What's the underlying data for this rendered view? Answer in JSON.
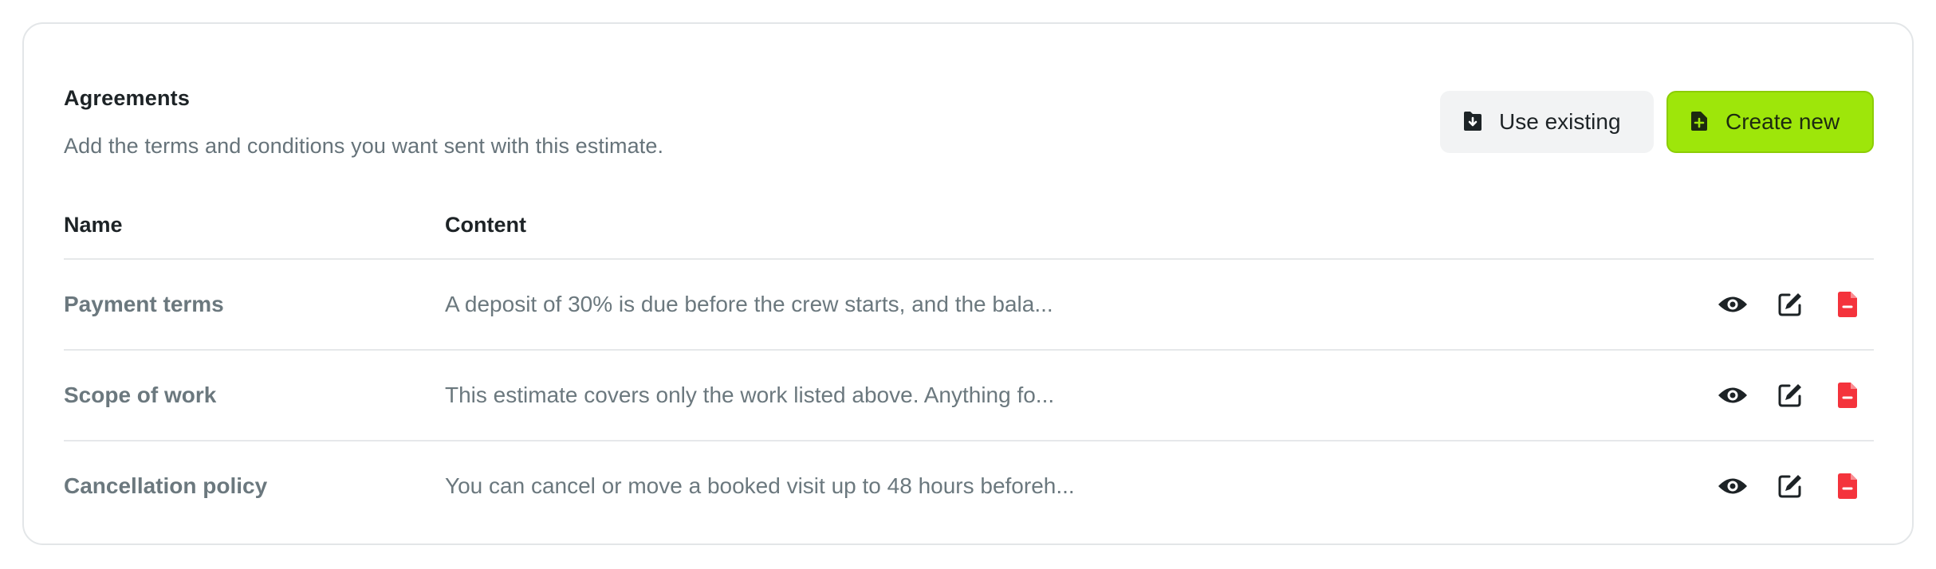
{
  "section": {
    "title": "Agreements",
    "subtitle": "Add the terms and conditions you want sent with this estimate."
  },
  "actions": {
    "use_existing_label": "Use existing",
    "use_existing_icon": "folder-download-icon",
    "create_new_label": "Create new",
    "create_new_icon": "file-plus-icon"
  },
  "table": {
    "columns": [
      "Name",
      "Content"
    ],
    "rows": [
      {
        "name": "Payment terms",
        "content": "A deposit of 30% is due before the crew starts, and the bala..."
      },
      {
        "name": "Scope of work",
        "content": "This estimate covers only the work listed above. Anything fo..."
      },
      {
        "name": "Cancellation policy",
        "content": "You can cancel or move a booked visit up to 48 hours beforeh..."
      }
    ],
    "row_action_icons": [
      "eye-icon",
      "edit-icon",
      "file-minus-icon"
    ]
  },
  "colors": {
    "primary": "#9ee60a",
    "danger": "#f4333c",
    "text_muted": "#6b787e"
  }
}
